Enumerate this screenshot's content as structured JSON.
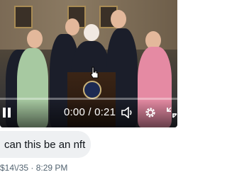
{
  "video": {
    "current_time": "0:00",
    "separator": "/",
    "duration": "0:21",
    "progress": 0.0
  },
  "message": {
    "text": "can this be an nft",
    "meta": "$14\\/35 · 8:29 PM"
  },
  "icons": {
    "play_state": "pause-icon",
    "volume": "volume-icon",
    "settings": "gear-icon",
    "fullscreen": "exit-fullscreen-icon",
    "cursor": "hand-cursor-icon"
  }
}
